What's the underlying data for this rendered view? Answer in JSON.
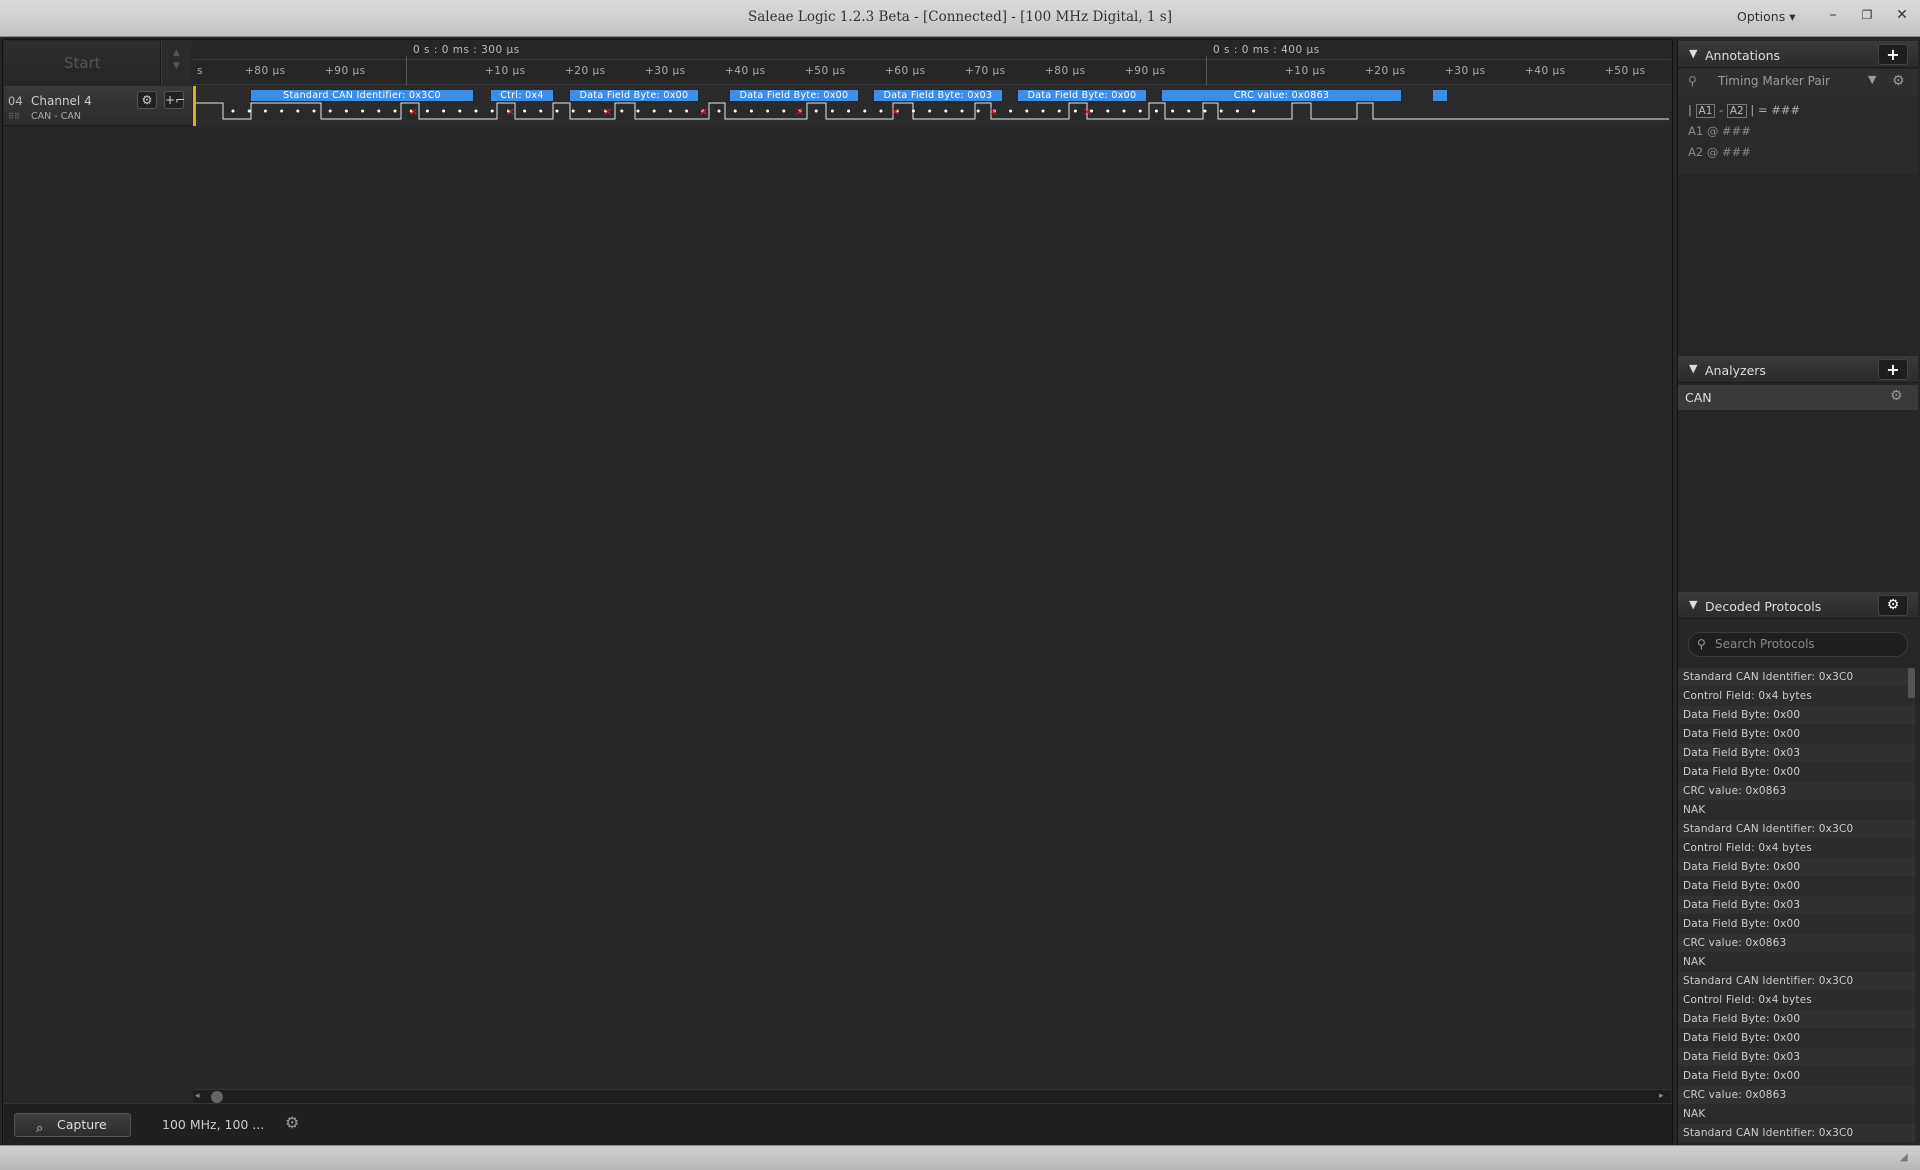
{
  "window": {
    "title": "Saleae Logic 1.2.3 Beta - [Connected] - [100 MHz Digital, 1 s]",
    "options_label": "Options",
    "minimize_glyph": "–",
    "restore_glyph": "❐",
    "close_glyph": "✕"
  },
  "capture": {
    "start_label": "Start"
  },
  "ruler": {
    "time_stamps": [
      "0 s : 0 ms : 300 μs",
      "0 s : 0 ms : 400 μs"
    ],
    "ticks": [
      "s",
      "+80 μs",
      "+90 μs",
      "+10 μs",
      "+20 μs",
      "+30 μs",
      "+40 μs",
      "+50 μs",
      "+60 μs",
      "+70 μs",
      "+80 μs",
      "+90 μs",
      "+10 μs",
      "+20 μs",
      "+30 μs",
      "+40 μs",
      "+50 μs"
    ]
  },
  "channel": {
    "number": "04",
    "name": "Channel 4",
    "analyzer": "CAN - CAN",
    "gear_icon": "gear-icon",
    "trigger_icon": "trigger-edge-icon"
  },
  "annotations_bar": [
    "Standard CAN Identifier: 0x3C0",
    "Ctrl: 0x4",
    "Data Field Byte: 0x00",
    "Data Field Byte: 0x00",
    "Data Field Byte: 0x03",
    "Data Field Byte: 0x00",
    "CRC value: 0x0863",
    ""
  ],
  "bottom": {
    "capture_tab": "Capture",
    "rate_info": "100 MHz, 100 ..."
  },
  "panels": {
    "annotations": {
      "title": "Annotations",
      "timing_marker": "Timing Marker Pair",
      "row_main_a1": "A1",
      "row_main_a2": "A2",
      "row_main_value": "= ###",
      "row_a1_label": "A1",
      "row_a1_value": "@  ###",
      "row_a2_label": "A2",
      "row_a2_value": "@  ###"
    },
    "analyzers": {
      "title": "Analyzers",
      "items": [
        "CAN"
      ]
    },
    "decoded": {
      "title": "Decoded Protocols",
      "search_placeholder": "Search Protocols",
      "items": [
        "Standard CAN Identifier: 0x3C0",
        "Control Field: 0x4 bytes",
        "Data Field Byte: 0x00",
        "Data Field Byte: 0x00",
        "Data Field Byte: 0x03",
        "Data Field Byte: 0x00",
        "CRC value: 0x0863",
        "NAK",
        "Standard CAN Identifier: 0x3C0",
        "Control Field: 0x4 bytes",
        "Data Field Byte: 0x00",
        "Data Field Byte: 0x00",
        "Data Field Byte: 0x03",
        "Data Field Byte: 0x00",
        "CRC value: 0x0863",
        "NAK",
        "Standard CAN Identifier: 0x3C0",
        "Control Field: 0x4 bytes",
        "Data Field Byte: 0x00",
        "Data Field Byte: 0x00",
        "Data Field Byte: 0x03",
        "Data Field Byte: 0x00",
        "CRC value: 0x0863",
        "NAK",
        "Standard CAN Identifier: 0x3C0"
      ]
    }
  },
  "colors": {
    "accent_blue": "#3a8ee6",
    "cursor_yellow": "#d6b11a",
    "error_red": "#e02020"
  }
}
